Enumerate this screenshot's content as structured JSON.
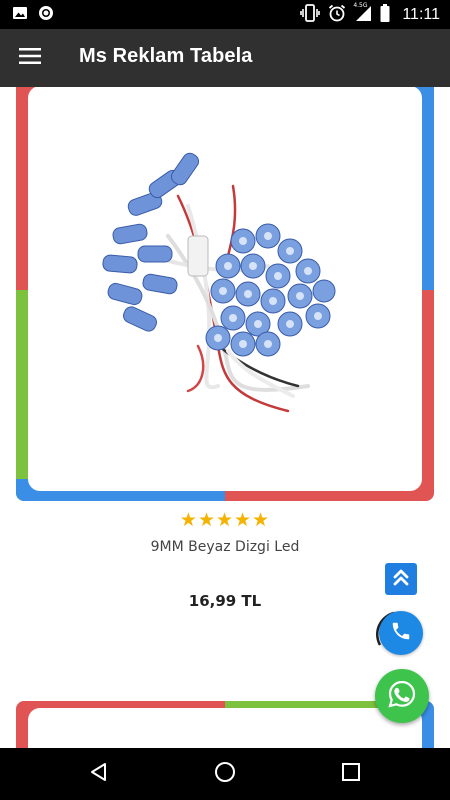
{
  "status_bar": {
    "time": "11:11",
    "network_label": "4.5G",
    "icons": [
      "image-icon",
      "record-icon",
      "vibrate-icon",
      "alarm-icon",
      "signal-icon",
      "battery-icon"
    ]
  },
  "app_bar": {
    "title": "Ms Reklam Tabela",
    "menu_icon": "hamburger-menu-icon"
  },
  "product": {
    "name": "9MM Beyaz Dizgi Led",
    "price": "16,99 TL",
    "rating": 5,
    "rating_stars": "★★★★★",
    "image_alt": "LED module cluster"
  },
  "floating": {
    "scroll_top_icon": "double-chevron-up-icon",
    "call_icon": "phone-icon",
    "whatsapp_icon": "whatsapp-icon"
  },
  "nav_bar": {
    "buttons": [
      "back-icon",
      "home-icon",
      "recents-icon"
    ]
  },
  "colors": {
    "red": "#e05454",
    "green": "#7dc23f",
    "blue": "#3a8ee6",
    "app_bar": "#303030",
    "star": "#f5b301",
    "scroll_top": "#1f7ee0",
    "call": "#1e88e5",
    "whatsapp": "#3ec34d"
  }
}
